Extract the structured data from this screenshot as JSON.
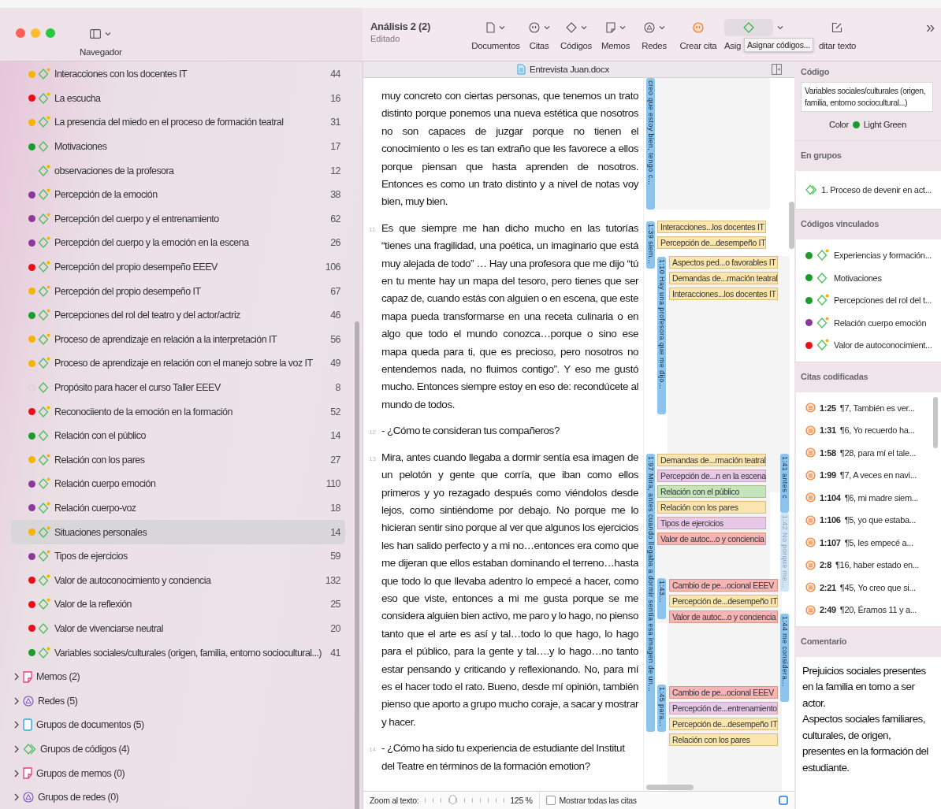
{
  "window": {
    "title": "Análisis 2 (2)",
    "subtitle": "Editado"
  },
  "toolbar": {
    "sidebar_label": "Navegador",
    "tooltip": "Asignar códigos...",
    "more": "»",
    "items": [
      {
        "kind": "documents",
        "label": "Documentos",
        "menu": true,
        "highlighted": false
      },
      {
        "kind": "quotes",
        "label": "Citas",
        "menu": true,
        "highlighted": false
      },
      {
        "kind": "codes",
        "label": "Códigos",
        "menu": true,
        "highlighted": false
      },
      {
        "kind": "memos",
        "label": "Memos",
        "menu": true,
        "highlighted": false
      },
      {
        "kind": "networks",
        "label": "Redes",
        "menu": true,
        "highlighted": false
      },
      {
        "kind": "create_quote",
        "label": "Crear cita",
        "menu": false,
        "highlighted": false
      },
      {
        "kind": "assign",
        "label": "Asig",
        "menu": true,
        "highlighted": true
      },
      {
        "kind": "edit",
        "label": "ditar texto",
        "menu": false,
        "highlighted": false
      }
    ]
  },
  "sidebar": {
    "codes": [
      {
        "label": "Interacciones con los docentes IT",
        "count": "44",
        "color": "#f4b400",
        "memo": true,
        "selected": false
      },
      {
        "label": "La escucha",
        "count": "16",
        "color": "#e8101a",
        "memo": true,
        "selected": false
      },
      {
        "label": "La presencia del miedo en el proceso de formación teatral",
        "count": "31",
        "color": "#f4b400",
        "memo": true,
        "selected": false
      },
      {
        "label": "Motivaciones",
        "count": "17",
        "color": "#1e9b2e",
        "memo": false,
        "selected": false
      },
      {
        "label": "observaciones de la profesora",
        "count": "12",
        "memo": true,
        "selected": false
      },
      {
        "label": "Percepción de la emoción",
        "count": "38",
        "color": "#8b3a9a",
        "memo": true,
        "selected": false
      },
      {
        "label": "Percepción del cuerpo y el entrenamiento",
        "count": "62",
        "color": "#8b3a9a",
        "memo": true,
        "selected": false
      },
      {
        "label": "Percepción del cuerpo y la emoción en la escena",
        "count": "26",
        "color": "#8b3a9a",
        "memo": true,
        "selected": false
      },
      {
        "label": "Percepción del propio desempeño  EEEV",
        "count": "106",
        "color": "#e8101a",
        "memo": true,
        "selected": false
      },
      {
        "label": "Percepción del propio desempeño IT",
        "count": "67",
        "color": "#f4b400",
        "memo": true,
        "selected": false
      },
      {
        "label": "Percepciones del rol del teatro y del actor/actriz",
        "count": "46",
        "color": "#1e9b2e",
        "memo": true,
        "selected": false
      },
      {
        "label": "Proceso de aprendizaje en relación a la interpretación IT",
        "count": "56",
        "color": "#f4b400",
        "memo": true,
        "selected": false
      },
      {
        "label": "Proceso de aprendizaje en relación con el manejo sobre la voz IT",
        "count": "49",
        "color": "#f4b400",
        "memo": true,
        "selected": false
      },
      {
        "label": "Propósito para hacer el curso Taller EEEV",
        "count": "8",
        "memo": false,
        "selected": false
      },
      {
        "label": "Reconociiento de la emoción en la formación",
        "count": "52",
        "color": "#e8101a",
        "memo": true,
        "selected": false
      },
      {
        "label": "Relación con el público",
        "count": "14",
        "color": "#1e9b2e",
        "memo": false,
        "selected": false
      },
      {
        "label": "Relación con los pares",
        "count": "27",
        "color": "#f4b400",
        "memo": true,
        "selected": false
      },
      {
        "label": "Relación cuerpo emoción",
        "count": "110",
        "color": "#8b3a9a",
        "memo": true,
        "selected": false
      },
      {
        "label": "Relación cuerpo-voz",
        "count": "18",
        "color": "#8b3a9a",
        "memo": true,
        "selected": false
      },
      {
        "label": "Situaciones personales",
        "count": "14",
        "color": "#f4b400",
        "memo": true,
        "selected": true
      },
      {
        "label": "Tipos de ejercicios",
        "count": "59",
        "color": "#8b3a9a",
        "memo": true,
        "selected": false
      },
      {
        "label": "Valor de autoconocimiento y conciencia",
        "count": "132",
        "color": "#e8101a",
        "memo": true,
        "selected": false
      },
      {
        "label": "Valor de la reflexión",
        "count": "25",
        "color": "#e8101a",
        "memo": true,
        "selected": false
      },
      {
        "label": "Valor de vivenciarse neutral",
        "count": "20",
        "color": "#e8101a",
        "memo": false,
        "selected": false
      },
      {
        "label": "Variables sociales/culturales (origen, familia, entorno sociocultural...)",
        "count": "41",
        "color": "#1e9b2e",
        "memo": true,
        "selected": false
      }
    ],
    "groups": [
      {
        "kind": "memo",
        "label": "Memos (2)"
      },
      {
        "kind": "network",
        "label": "Redes (5)"
      },
      {
        "kind": "document",
        "label": "Grupos de documentos (5)"
      },
      {
        "kind": "codegroup",
        "label": "Grupos de códigos (4)"
      },
      {
        "kind": "memo",
        "label": "Grupos de memos (0)"
      },
      {
        "kind": "network",
        "label": "Grupos de redes (0)"
      }
    ]
  },
  "document": {
    "title": "Entrevista Juan.docx",
    "paragraphs": [
      {
        "kind": "answer",
        "text": "muy concreto con ciertas personas, que tenemos un trato distinto porque ponemos una nueva estética que nosotros no son capaces de juzgar porque no tienen el conocimiento o les es tan extraño que les favorece a ellos porque piensan que hasta aprenden de nosotros. Entonces es como un trato distinto y a nivel de notas voy bien, muy bien."
      },
      {
        "kind": "answer",
        "number": "11",
        "text": "Es que siempre me han dicho mucho en las tutorías “tienes una fragilidad, una poética, un imaginario que está muy alejada de todo” … Hay una profesora que me dijo “tú en tu mente hay un mapa del tesoro, pero tienes que ser capaz de, cuando estás con alguien o en escena, que este mapa pueda transformarse en una receta culinaria o en algo que todo el mundo conozca…porque o sino ese mapa queda para ti, que es precioso, pero nosotros no entendemos nada, no fluimos contigo”. Y eso me gustó mucho. Entonces siempre estoy en eso de:  recondúcete al mundo de todos."
      },
      {
        "kind": "question",
        "number": "12",
        "text": "- ¿Cómo te consideran tus compañeros?"
      },
      {
        "kind": "answer",
        "number": "13",
        "text": "Mira, antes cuando llegaba a dormir sentía esa imagen de un pelotón y gente que corría, que iban como ellos primeros y yo rezagado después como viéndolos desde lejos, como sintiéndome por debajo. No porque me lo hicieran sentir sino porque al ver que algunos los ejercicios les han salido perfecto y a mi no…entonces era como que me dijeran que ellos estaban dominando el terreno…hasta que todo lo que llevaba adentro lo empecé a hacer, como eso que viste, entonces a mi me gusta porque se me considera alguien bien activo, me paro y lo hago, no pienso tanto que el arte es así y tal…todo lo que hago, lo hago para el público, para la gente y tal….y lo hago…no tanto estar pensando y criticando y reflexionando. No, para mí es el hacer todo el rato. Bueno, desde mí opinión, también pienso que aporto a grupo mucho coraje, a sacar y mostrar y hacer."
      },
      {
        "kind": "question",
        "number": "14",
        "text": "- ¿Cómo ha sido tu experiencia de estudiante del Institut del Teatre en términos de la formación emotion?"
      }
    ]
  },
  "margin": {
    "quotes": [
      {
        "label": "creo que estoy bien, tengo c..."
      },
      {
        "label": "1:39 siem..."
      },
      {
        "label": "1:10 Hay una profesora que me dijo..."
      },
      {
        "label": "1:97 Mira, antes cuando llegaba a dormir sentía esa imagen de un..."
      },
      {
        "label": "1:43..."
      },
      {
        "label": "1:45 para..."
      },
      {
        "label": "1:41 antes c"
      },
      {
        "label": "1:42 No porque me..."
      },
      {
        "label": "1:44 me considera..."
      }
    ],
    "tag_groups": [
      {
        "tags": [
          {
            "label": "Interacciones...los docentes IT",
            "color": "#fce6b0"
          },
          {
            "label": "Percepción de...desempeño IT",
            "color": "#fce6b0"
          }
        ]
      },
      {
        "tags": [
          {
            "label": "Aspectos ped...o favorables IT",
            "color": "#fce6b0"
          },
          {
            "label": "Demandas de...rmación teatral",
            "color": "#fce6b0"
          },
          {
            "label": "Interacciones...los docentes IT",
            "color": "#fce6b0"
          }
        ]
      },
      {
        "tags": [
          {
            "label": "Demandas de...rmación teatral",
            "color": "#fce6b0"
          },
          {
            "label": "Percepción de...n en la escena",
            "color": "#e8c8e8"
          },
          {
            "label": "Relación con el público",
            "color": "#c4e4bc"
          },
          {
            "label": "Relación con los pares",
            "color": "#fce6b0"
          },
          {
            "label": "Tipos de ejercicios",
            "color": "#e8c8e8"
          },
          {
            "label": "Valor de autoc...o y conciencia",
            "color": "#f7b4b4"
          }
        ]
      },
      {
        "tags": [
          {
            "label": "Cambio de pe...ocional  EEEV",
            "color": "#f7b4b4"
          },
          {
            "label": "Percepción de...desempeño IT",
            "color": "#fce6b0"
          },
          {
            "label": "Valor de autoc...o y conciencia",
            "color": "#f7b4b4"
          }
        ]
      },
      {
        "tags": [
          {
            "label": "Cambio de pe...ocional  EEEV",
            "color": "#f7b4b4"
          },
          {
            "label": "Percepción de...entrenamiento",
            "color": "#e8c8e8"
          },
          {
            "label": "Percepción de...desempeño IT",
            "color": "#fce6b0"
          },
          {
            "label": "Relación con los pares",
            "color": "#fce6b0"
          }
        ]
      }
    ]
  },
  "zoom": {
    "label": "Zoom al texto:",
    "level": 0.35,
    "reading": "125 %"
  },
  "show_all": {
    "label": "Mostrar todas las citas",
    "checked": false
  },
  "inspector": {
    "code_header": "Código",
    "code_name": "Variables sociales/culturales (origen, familia, entorno sociocultural...)",
    "color_label": "Color",
    "color_name": "Light Green",
    "color": "#1e9b2e",
    "groups_header": "En grupos",
    "groups": [
      "1. Proceso de devenir en act..."
    ],
    "linked_header": "Códigos vinculados",
    "linked": [
      {
        "label": "Experiencias y formación...",
        "color": "#1e9b2e",
        "memo": true
      },
      {
        "label": "Motivaciones",
        "color": "#1e9b2e",
        "memo": false
      },
      {
        "label": "Percepciones del rol del t...",
        "color": "#1e9b2e",
        "memo": true
      },
      {
        "label": "Relación cuerpo emoción",
        "color": "#8b3a9a",
        "memo": true
      },
      {
        "label": "Valor de autoconocimient...",
        "color": "#e8101a",
        "memo": true
      }
    ],
    "quotes_header": "Citas codificadas",
    "quotes": [
      {
        "id": "1:25",
        "text": "¶7, También es ver..."
      },
      {
        "id": "1:31",
        "text": "¶6, Yo recuerdo ha..."
      },
      {
        "id": "1:58",
        "text": "¶28, para mí el tale..."
      },
      {
        "id": "1:99",
        "text": "¶7, A veces en navi..."
      },
      {
        "id": "1:104",
        "text": "¶6, mi madre siem..."
      },
      {
        "id": "1:106",
        "text": "¶5, yo que estaba..."
      },
      {
        "id": "1:107",
        "text": "¶5, les empecé a..."
      },
      {
        "id": "2:8",
        "text": "¶16, haber estado en..."
      },
      {
        "id": "2:21",
        "text": "¶45, Yo creo que si..."
      },
      {
        "id": "2:49",
        "text": "¶20, Éramos 11 y a..."
      }
    ],
    "comment_header": "Comentario",
    "comment": [
      "Prejuicios sociales presentes en la familia en torno a ser actor.",
      "Aspectos sociales familiares, culturales, de origen, presentes en la formación del estudiante."
    ]
  }
}
